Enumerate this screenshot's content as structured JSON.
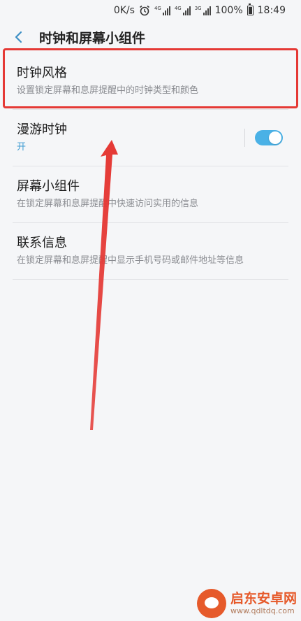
{
  "status_bar": {
    "speed": "0K/s",
    "net1": "4G",
    "net2": "4G",
    "net3": "3G",
    "battery": "100%",
    "time": "18:49"
  },
  "header": {
    "title": "时钟和屏幕小组件"
  },
  "items": [
    {
      "title": "时钟风格",
      "subtitle": "设置锁定屏幕和息屏提醒中的时钟类型和颜色"
    },
    {
      "title": "漫游时钟",
      "subtitle": "开",
      "toggle_on": true
    },
    {
      "title": "屏幕小组件",
      "subtitle": "在锁定屏幕和息屏提醒中快速访问实用的信息"
    },
    {
      "title": "联系信息",
      "subtitle": "在锁定屏幕和息屏提醒中显示手机号码或邮件地址等信息"
    }
  ],
  "colors": {
    "accent": "#4ab1e6",
    "annotation": "#e53935",
    "background": "#f5f6f8"
  },
  "watermark": {
    "name": "启东安卓网",
    "url": "www.qdltdq.com"
  }
}
